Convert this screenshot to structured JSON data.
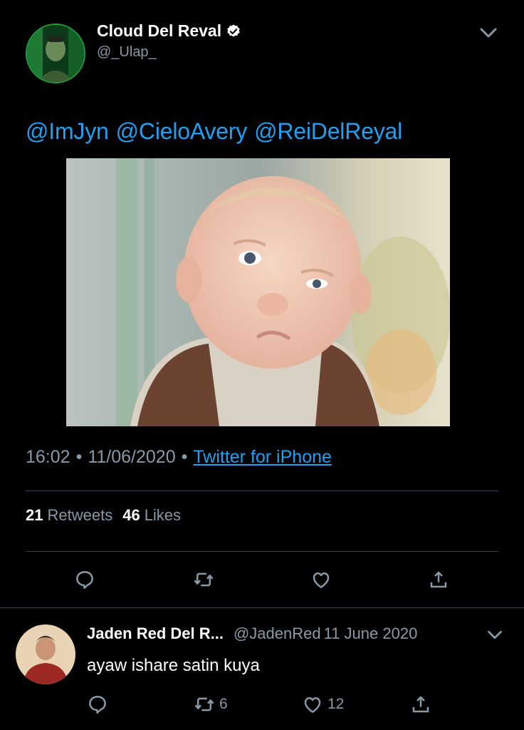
{
  "tweet": {
    "author_name": "Cloud Del Reval",
    "author_handle": "@_Ulap_",
    "verified": true,
    "mentions": [
      "@ImJyn",
      "@CieloAvery",
      "@ReiDelReyal"
    ],
    "time": "16:02",
    "date": "11/06/2020",
    "source": "Twitter for iPhone",
    "retweets_count": "21",
    "retweets_label": "Retweets",
    "likes_count": "46",
    "likes_label": "Likes"
  },
  "reply": {
    "author_name": "Jaden Red Del R...",
    "author_handle": "@JadenRed",
    "date": "11 June 2020",
    "text": "ayaw ishare satin kuya",
    "retweets_count": "6",
    "likes_count": "12"
  },
  "colors": {
    "background": "#000000",
    "link": "#1da1f2",
    "muted": "#8899a6",
    "divider": "#38444d"
  },
  "icons": [
    "verified-badge-icon",
    "chevron-down-icon",
    "reply-icon",
    "retweet-icon",
    "like-icon",
    "share-icon"
  ]
}
